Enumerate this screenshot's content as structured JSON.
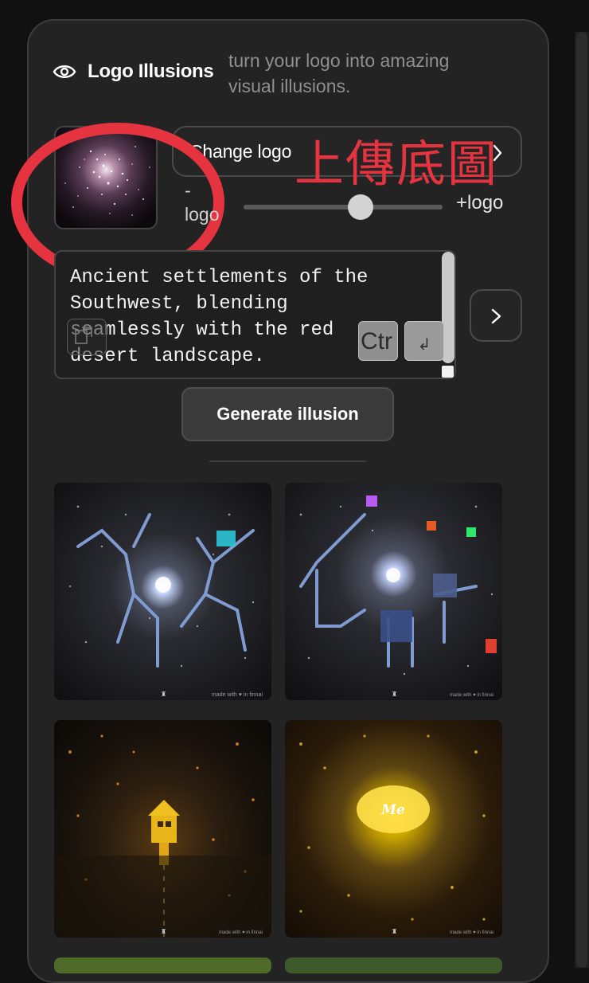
{
  "header": {
    "title": "Logo Illusions",
    "description": "turn your logo into amazing visual illusions."
  },
  "logo": {
    "change_label": "Change logo"
  },
  "annotation": {
    "text": "上傳底圖",
    "color": "#e5343f"
  },
  "slider": {
    "minus_symbol": "-",
    "minus_label": "logo",
    "plus_label": "+logo",
    "value": 0.53
  },
  "prompt": {
    "text": "Ancient settlements of the\nSouthwest, blending\nseamlessly with the red\ndesert landscape.",
    "ctrl_key": "Ctr",
    "enter_key": "↲"
  },
  "generate": {
    "label": "Generate illusion"
  },
  "gallery": {
    "watermark": "made with ♥ in finnai",
    "logo_mark": "♜",
    "image4_text": "Me"
  },
  "icons": {
    "visibility": "eye-icon",
    "chevron": "chevron-right-icon",
    "copy": "copy-icon"
  }
}
